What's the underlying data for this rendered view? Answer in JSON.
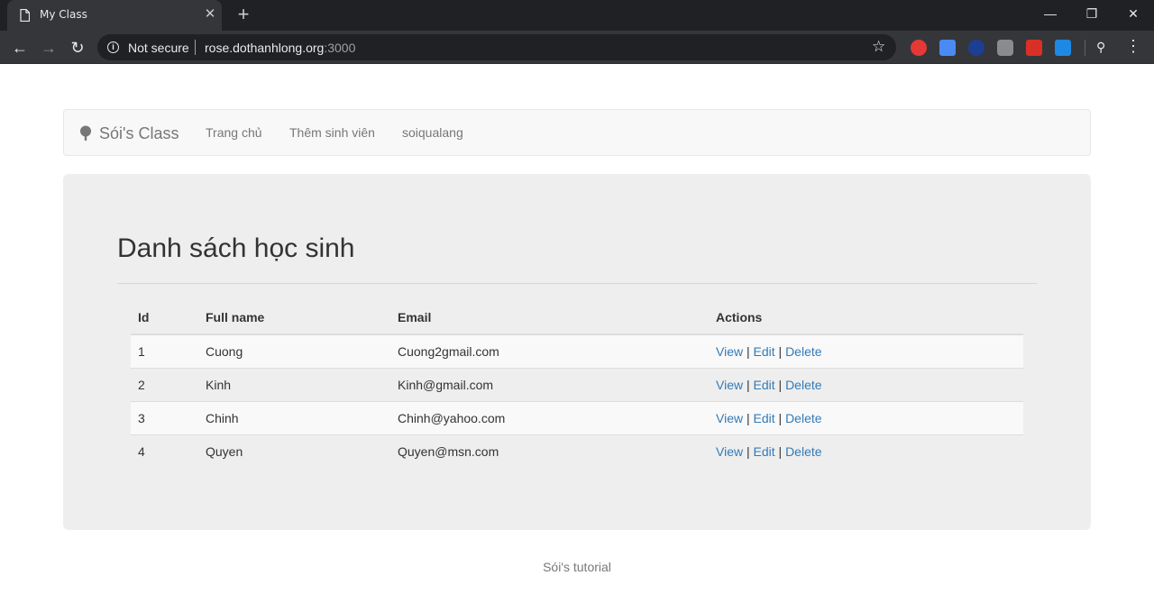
{
  "browser": {
    "tab_title": "My Class",
    "tab_close": "✕",
    "new_tab": "+",
    "security_label": "Not secure",
    "url_host": "rose.dothanhlong.org",
    "url_port": ":3000"
  },
  "navbar": {
    "brand": "Sói's Class",
    "links": [
      "Trang chủ",
      "Thêm sinh viên",
      "soiqualang"
    ]
  },
  "main": {
    "title": "Danh sách học sinh",
    "table": {
      "headers": [
        "Id",
        "Full name",
        "Email",
        "Actions"
      ],
      "rows": [
        {
          "id": "1",
          "name": "Cuong",
          "email": "Cuong2gmail.com"
        },
        {
          "id": "2",
          "name": "Kinh",
          "email": "Kinh@gmail.com"
        },
        {
          "id": "3",
          "name": "Chinh",
          "email": "Chinh@yahoo.com"
        },
        {
          "id": "4",
          "name": "Quyen",
          "email": "Quyen@msn.com"
        }
      ],
      "actions": {
        "view": "View",
        "edit": "Edit",
        "delete": "Delete",
        "separator": "|"
      }
    }
  },
  "footer": {
    "text": "Sói's tutorial"
  },
  "colors": {
    "link": "#337ab7",
    "jumbotron": "#eeeeee",
    "chrome_dark": "#202124"
  }
}
